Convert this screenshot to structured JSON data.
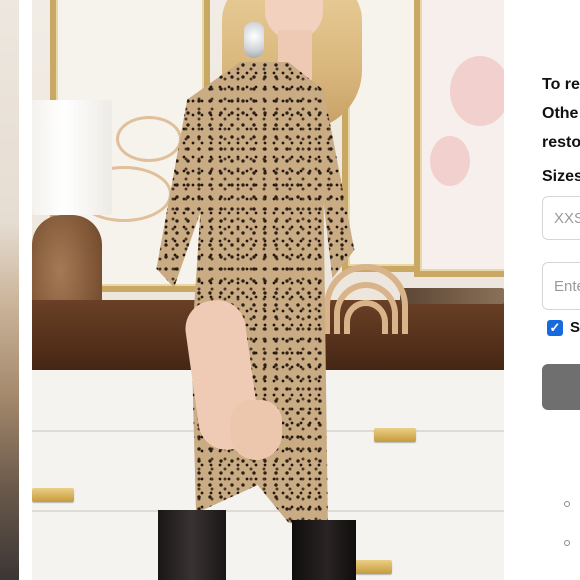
{
  "product_image": {
    "alt": ""
  },
  "notify_panel": {
    "line_1": "To re",
    "line_2": "Othe",
    "line_3": "resto",
    "sizes_label": "Sizes",
    "size_select": {
      "value": "XXS"
    },
    "email_field": {
      "placeholder": "Ente"
    },
    "checkbox": {
      "checked": true,
      "label": "S"
    }
  },
  "colors": {
    "checkbox_blue": "#1769e0",
    "button_gray": "#6f6f6f",
    "handle_gold": "#c69b3c"
  }
}
